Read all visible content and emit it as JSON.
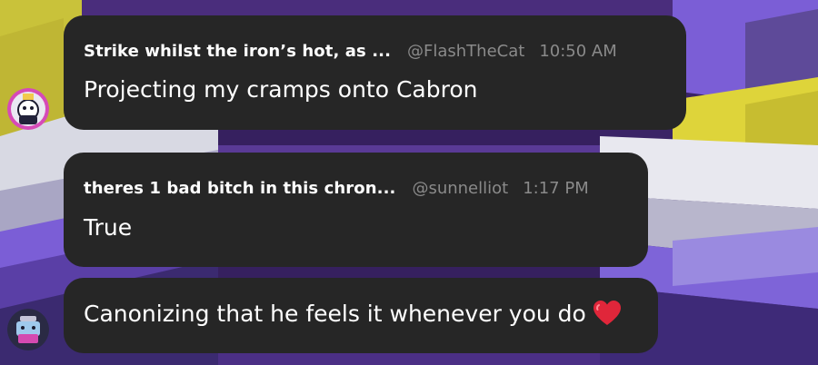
{
  "messages": [
    {
      "author": "Strike whilst the iron’s hot, as ...",
      "handle": "@FlashTheCat",
      "time": "10:50 AM",
      "text": "Projecting my cramps onto Cabron"
    },
    {
      "author": "theres 1 bad bitch in this chron...",
      "handle": "@sunnelliot",
      "time": "1:17 PM",
      "text": "True"
    },
    {
      "text": "Canonizing that he feels it whenever you do",
      "emoji": "heart-emoji"
    }
  ],
  "avatars": [
    {
      "icon": "flashthecat-avatar"
    },
    {
      "icon": "sunnelliot-avatar"
    }
  ],
  "colors": {
    "bubble": "#262626",
    "meta_text": "#8a8a8a",
    "accent_yellow": "#e3d63c",
    "accent_purple": "#6a3fb0"
  }
}
